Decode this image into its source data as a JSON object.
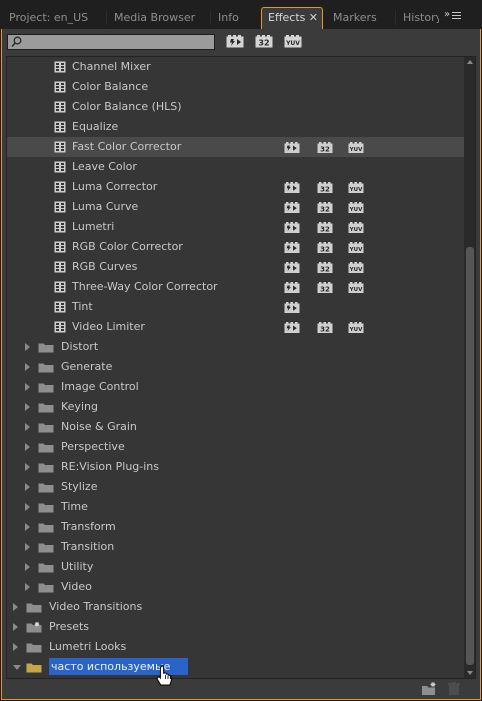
{
  "tabs": [
    {
      "label": "Project: en_US",
      "key": "project"
    },
    {
      "label": "Media Browser",
      "key": "media"
    },
    {
      "label": "Info",
      "key": "info"
    },
    {
      "label": "Effects",
      "key": "effects",
      "active": true,
      "close": "✕"
    },
    {
      "label": "Markers",
      "key": "markers"
    },
    {
      "label": "History",
      "key": "history"
    }
  ],
  "panel_menu_glyph": "»",
  "colors": {
    "accent": "#e19a1d",
    "selection": "#2b64c9",
    "folder": "#8e8e8e",
    "open_folder": "#c9a54a"
  },
  "search": {
    "value": "",
    "placeholder": ""
  },
  "toolbar": {
    "accelerated_icon": "accelerated-effects-icon",
    "bit32_label": "32",
    "yuv_label": "YUV"
  },
  "badges": {
    "bit32": "32",
    "yuv": "YUV"
  },
  "tree": [
    {
      "label": "Channel Mixer",
      "kind": "effect",
      "level": 3,
      "accel": false,
      "bit32": false,
      "yuv": false
    },
    {
      "label": "Color Balance",
      "kind": "effect",
      "level": 3,
      "accel": false,
      "bit32": false,
      "yuv": false
    },
    {
      "label": "Color Balance (HLS)",
      "kind": "effect",
      "level": 3,
      "accel": false,
      "bit32": false,
      "yuv": false
    },
    {
      "label": "Equalize",
      "kind": "effect",
      "level": 3,
      "accel": false,
      "bit32": false,
      "yuv": false
    },
    {
      "label": "Fast Color Corrector",
      "kind": "effect",
      "level": 3,
      "accel": true,
      "bit32": true,
      "yuv": true,
      "hover": true
    },
    {
      "label": "Leave Color",
      "kind": "effect",
      "level": 3,
      "accel": false,
      "bit32": false,
      "yuv": false
    },
    {
      "label": "Luma Corrector",
      "kind": "effect",
      "level": 3,
      "accel": true,
      "bit32": true,
      "yuv": true
    },
    {
      "label": "Luma Curve",
      "kind": "effect",
      "level": 3,
      "accel": true,
      "bit32": true,
      "yuv": true
    },
    {
      "label": "Lumetri",
      "kind": "effect",
      "level": 3,
      "accel": true,
      "bit32": true,
      "yuv": true
    },
    {
      "label": "RGB Color Corrector",
      "kind": "effect",
      "level": 3,
      "accel": true,
      "bit32": true,
      "yuv": true
    },
    {
      "label": "RGB Curves",
      "kind": "effect",
      "level": 3,
      "accel": true,
      "bit32": true,
      "yuv": true
    },
    {
      "label": "Three-Way Color Corrector",
      "kind": "effect",
      "level": 3,
      "accel": true,
      "bit32": true,
      "yuv": true
    },
    {
      "label": "Tint",
      "kind": "effect",
      "level": 3,
      "accel": true,
      "bit32": false,
      "yuv": false
    },
    {
      "label": "Video Limiter",
      "kind": "effect",
      "level": 3,
      "accel": true,
      "bit32": true,
      "yuv": true
    },
    {
      "label": "Distort",
      "kind": "folder",
      "level": 2,
      "expanded": false
    },
    {
      "label": "Generate",
      "kind": "folder",
      "level": 2,
      "expanded": false
    },
    {
      "label": "Image Control",
      "kind": "folder",
      "level": 2,
      "expanded": false
    },
    {
      "label": "Keying",
      "kind": "folder",
      "level": 2,
      "expanded": false
    },
    {
      "label": "Noise & Grain",
      "kind": "folder",
      "level": 2,
      "expanded": false
    },
    {
      "label": "Perspective",
      "kind": "folder",
      "level": 2,
      "expanded": false
    },
    {
      "label": "RE:Vision Plug-ins",
      "kind": "folder",
      "level": 2,
      "expanded": false
    },
    {
      "label": "Stylize",
      "kind": "folder",
      "level": 2,
      "expanded": false
    },
    {
      "label": "Time",
      "kind": "folder",
      "level": 2,
      "expanded": false
    },
    {
      "label": "Transform",
      "kind": "folder",
      "level": 2,
      "expanded": false
    },
    {
      "label": "Transition",
      "kind": "folder",
      "level": 2,
      "expanded": false
    },
    {
      "label": "Utility",
      "kind": "folder",
      "level": 2,
      "expanded": false
    },
    {
      "label": "Video",
      "kind": "folder",
      "level": 2,
      "expanded": false
    },
    {
      "label": "Video Transitions",
      "kind": "folder",
      "level": 1,
      "expanded": false
    },
    {
      "label": "Presets",
      "kind": "folder-star",
      "level": 1,
      "expanded": false
    },
    {
      "label": "Lumetri Looks",
      "kind": "folder",
      "level": 1,
      "expanded": false
    },
    {
      "label": "часто используемые",
      "kind": "folder-open",
      "level": 1,
      "expanded": true,
      "selected": true,
      "editing": true
    }
  ],
  "footer": {
    "new_bin_icon": "new-custom-bin-icon",
    "delete_icon": "trash-icon"
  }
}
